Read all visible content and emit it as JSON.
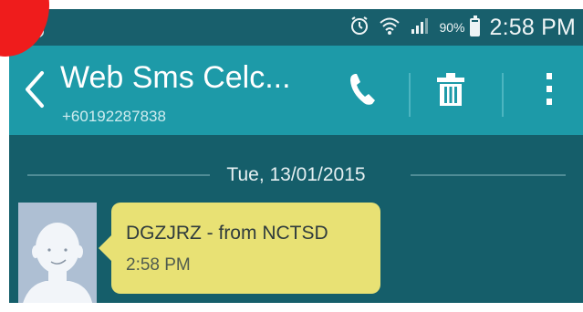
{
  "status_bar": {
    "time": "2:58 PM",
    "battery_percent": "90%",
    "battery_level": 0.9,
    "icons": [
      "screenshot-notification-icon",
      "alarm-icon",
      "wifi-icon",
      "signal-icon",
      "battery-icon"
    ]
  },
  "conversation": {
    "contact_name": "Web Sms Celc...",
    "phone_number": "+60192287838",
    "actions": [
      "back-icon",
      "call-icon",
      "delete-icon",
      "overflow-menu-icon"
    ]
  },
  "thread": {
    "date_header": "Tue, 13/01/2015",
    "messages": [
      {
        "text": "DGZJRZ - from NCTSD",
        "time": "2:58 PM",
        "bubble_color": "#e8e174"
      }
    ]
  },
  "colors": {
    "status_bar": "#185f6c",
    "action_bar": "#1d9aa8",
    "background": "#155e6a",
    "bubble": "#e8e174",
    "marker": "#ef1c1c"
  }
}
